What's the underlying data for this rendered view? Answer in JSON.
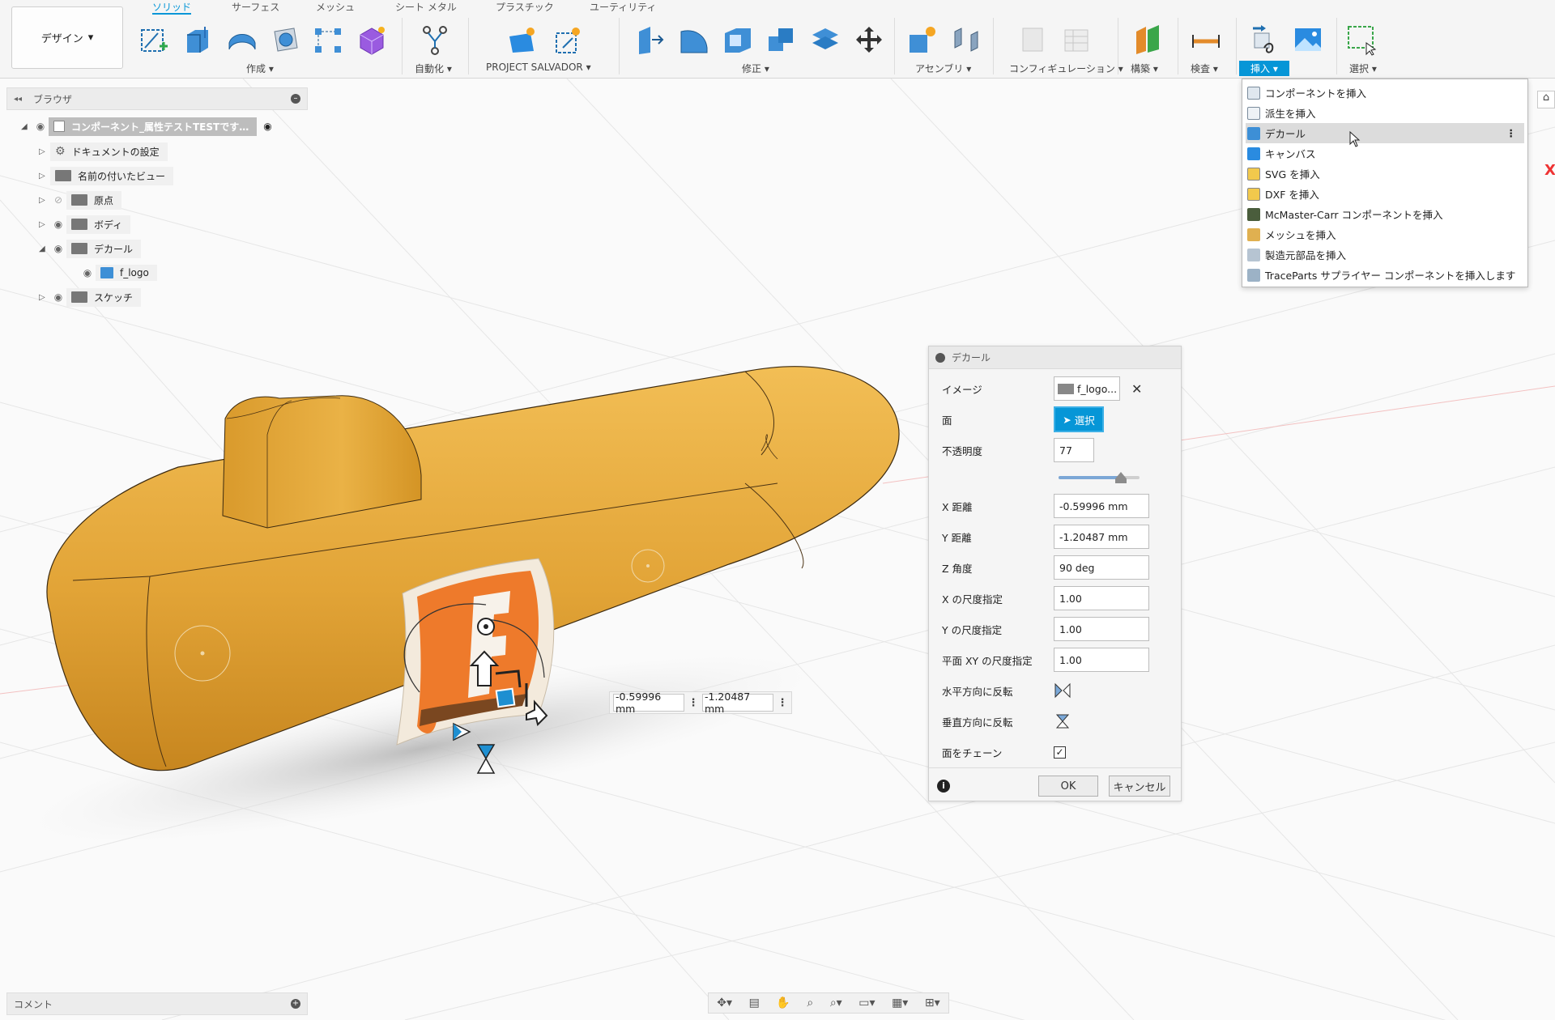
{
  "toolbar": {
    "workspace": "デザイン",
    "tabs": [
      "ソリッド",
      "サーフェス",
      "メッシュ",
      "シート メタル",
      "プラスチック",
      "ユーティリティ"
    ],
    "groups": {
      "create": "作成",
      "automate": "自動化",
      "project": "PROJECT SALVADOR",
      "modify": "修正",
      "assemble": "アセンブリ",
      "configure": "コンフィギュレーション",
      "construct": "構築",
      "inspect": "検査",
      "insert": "挿入",
      "select": "選択"
    }
  },
  "browser": {
    "title": "ブラウザ",
    "root": "コンポーネント_属性テストTESTです…",
    "items": [
      "ドキュメントの設定",
      "名前の付いたビュー",
      "原点",
      "ボディ",
      "デカール",
      "f_logo",
      "スケッチ"
    ]
  },
  "insert_menu": {
    "items": [
      "コンポーネントを挿入",
      "派生を挿入",
      "デカール",
      "キャンバス",
      "SVG を挿入",
      "DXF を挿入",
      "McMaster-Carr コンポーネントを挿入",
      "メッシュを挿入",
      "製造元部品を挿入",
      "TraceParts サプライヤー コンポーネントを挿入します"
    ]
  },
  "decal_dialog": {
    "title": "デカール",
    "image_label": "イメージ",
    "image_value": "f_logo...",
    "face_label": "面",
    "select_button": "選択",
    "opacity_label": "不透明度",
    "opacity_value": "77",
    "opacity": 0.77,
    "x_distance_label": "X 距離",
    "x_distance": "-0.59996 mm",
    "y_distance_label": "Y 距離",
    "y_distance": "-1.20487 mm",
    "z_angle_label": "Z 角度",
    "z_angle": "90 deg",
    "x_scale_label": "X の尺度指定",
    "x_scale": "1.00",
    "y_scale_label": "Y の尺度指定",
    "y_scale": "1.00",
    "xy_scale_label": "平面 XY の尺度指定",
    "xy_scale": "1.00",
    "flip_h_label": "水平方向に反転",
    "flip_v_label": "垂直方向に反転",
    "chain_label": "面をチェーン",
    "chain_checked": true,
    "ok": "OK",
    "cancel": "キャンセル"
  },
  "viewport": {
    "coord_x": "-0.59996 mm",
    "coord_y": "-1.20487 mm",
    "axis_label": "X"
  },
  "comments": {
    "title": "コメント"
  },
  "colors": {
    "accent": "#0696d7",
    "body": "#e3a73a",
    "decal": "#ee7a2b"
  }
}
